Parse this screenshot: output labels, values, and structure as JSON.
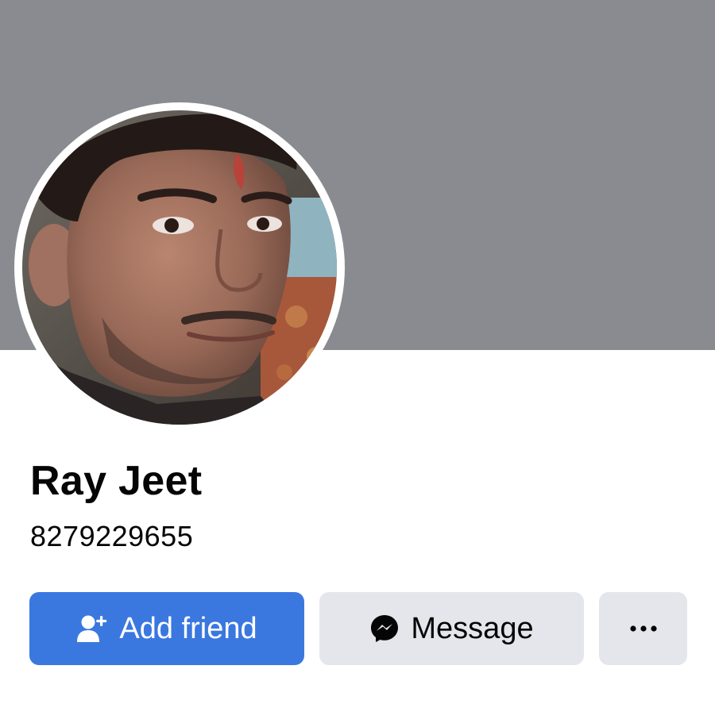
{
  "profile": {
    "name": "Ray Jeet",
    "subtitle": "8279229655"
  },
  "actions": {
    "add_friend_label": "Add friend",
    "message_label": "Message",
    "more_icon": "more-horizontal-icon"
  },
  "colors": {
    "cover": "#8a8b90",
    "primary_button": "#3a78e0",
    "secondary_button": "#e4e6eb"
  }
}
